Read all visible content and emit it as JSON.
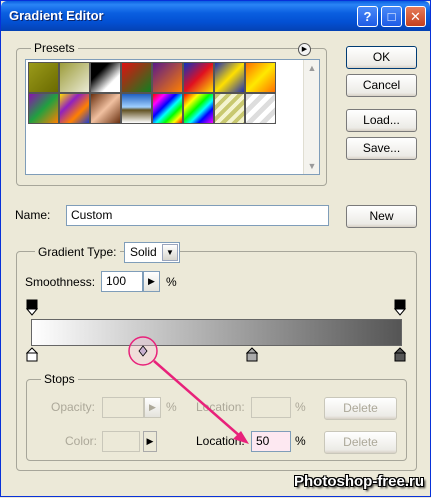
{
  "window": {
    "title": "Gradient Editor"
  },
  "title_buttons": {
    "help": "?",
    "maximize": "□",
    "close": "✕"
  },
  "presets": {
    "label": "Presets",
    "swatches": [
      {
        "name": "foreground-to-background",
        "css": "linear-gradient(135deg, #9a9a1a, #6a6a00)"
      },
      {
        "name": "foreground-to-transparent",
        "css": "linear-gradient(135deg, #9c9c3a 0%, rgba(150,150,40,0.2) 100%)"
      },
      {
        "name": "black-white",
        "css": "linear-gradient(135deg, #000 30%, #fff 70%)"
      },
      {
        "name": "red-green",
        "css": "linear-gradient(135deg, #e01010, #108020)"
      },
      {
        "name": "violet-orange",
        "css": "linear-gradient(135deg, #5a1a8a, #ff8000)"
      },
      {
        "name": "blue-red-yellow",
        "css": "linear-gradient(135deg, #1030c0, #e01020 50%, #ffe000)"
      },
      {
        "name": "blue-yellow-blue",
        "css": "linear-gradient(135deg, #2030b0, #ffe000 50%, #2030b0)"
      },
      {
        "name": "orange-yellow-orange",
        "css": "linear-gradient(135deg, #ff7000, #ffe800 50%, #ff7000)"
      },
      {
        "name": "violet-green-orange",
        "css": "linear-gradient(135deg, #8a10b0, #20a040 50%, #ff8000)"
      },
      {
        "name": "yellow-violet-orange-blue",
        "css": "linear-gradient(135deg, #ffe000, #9020c0 33%, #ff8000 66%, #2040d0)"
      },
      {
        "name": "copper",
        "css": "linear-gradient(135deg, #6a3010, #f0c0a0 50%, #6a3010)"
      },
      {
        "name": "chrome",
        "css": "linear-gradient(180deg, #2060c0 0%, #a0d0ff 45%, #605020 55%, #fff 100%)"
      },
      {
        "name": "spectrum",
        "css": "linear-gradient(135deg, #ff0000, #ff00ff 20%, #0000ff 40%, #00ffff 55%, #00ff00 70%, #ffff00 85%, #ff0000)"
      },
      {
        "name": "transparent-rainbow",
        "css": "linear-gradient(135deg, #ff0000, #ffff00 25%, #00ff00 45%, #00ffff 60%, #0000ff 75%, #ff00ff)"
      },
      {
        "name": "transparent-stripes",
        "css": "repeating-linear-gradient(135deg, #c8c870 0 4px, #f4f4d0 4px 8px)"
      },
      {
        "name": "checker-transparent",
        "css": "repeating-linear-gradient(135deg, #ddd 0 5px, #fff 5px 10px)"
      }
    ]
  },
  "buttons": {
    "ok": "OK",
    "cancel": "Cancel",
    "load": "Load...",
    "save": "Save...",
    "new": "New"
  },
  "name_field": {
    "label": "Name:",
    "value": "Custom"
  },
  "gradient_type": {
    "label": "Gradient Type:",
    "value": "Solid"
  },
  "smoothness": {
    "label": "Smoothness:",
    "value": "100",
    "unit": "%"
  },
  "stops": {
    "label": "Stops",
    "opacity_label": "Opacity:",
    "opacity_value": "",
    "opacity_unit": "%",
    "opacity_location_label": "Location:",
    "opacity_location_value": "",
    "opacity_location_unit": "%",
    "opacity_delete": "Delete",
    "color_label": "Color:",
    "color_location_label": "Location:",
    "color_location_value": "50",
    "color_location_unit": "%",
    "color_delete": "Delete"
  },
  "watermark": "Photoshop-free.ru",
  "colors": {
    "highlight": "#e8217a",
    "title_blue": "#0a5fe0"
  }
}
